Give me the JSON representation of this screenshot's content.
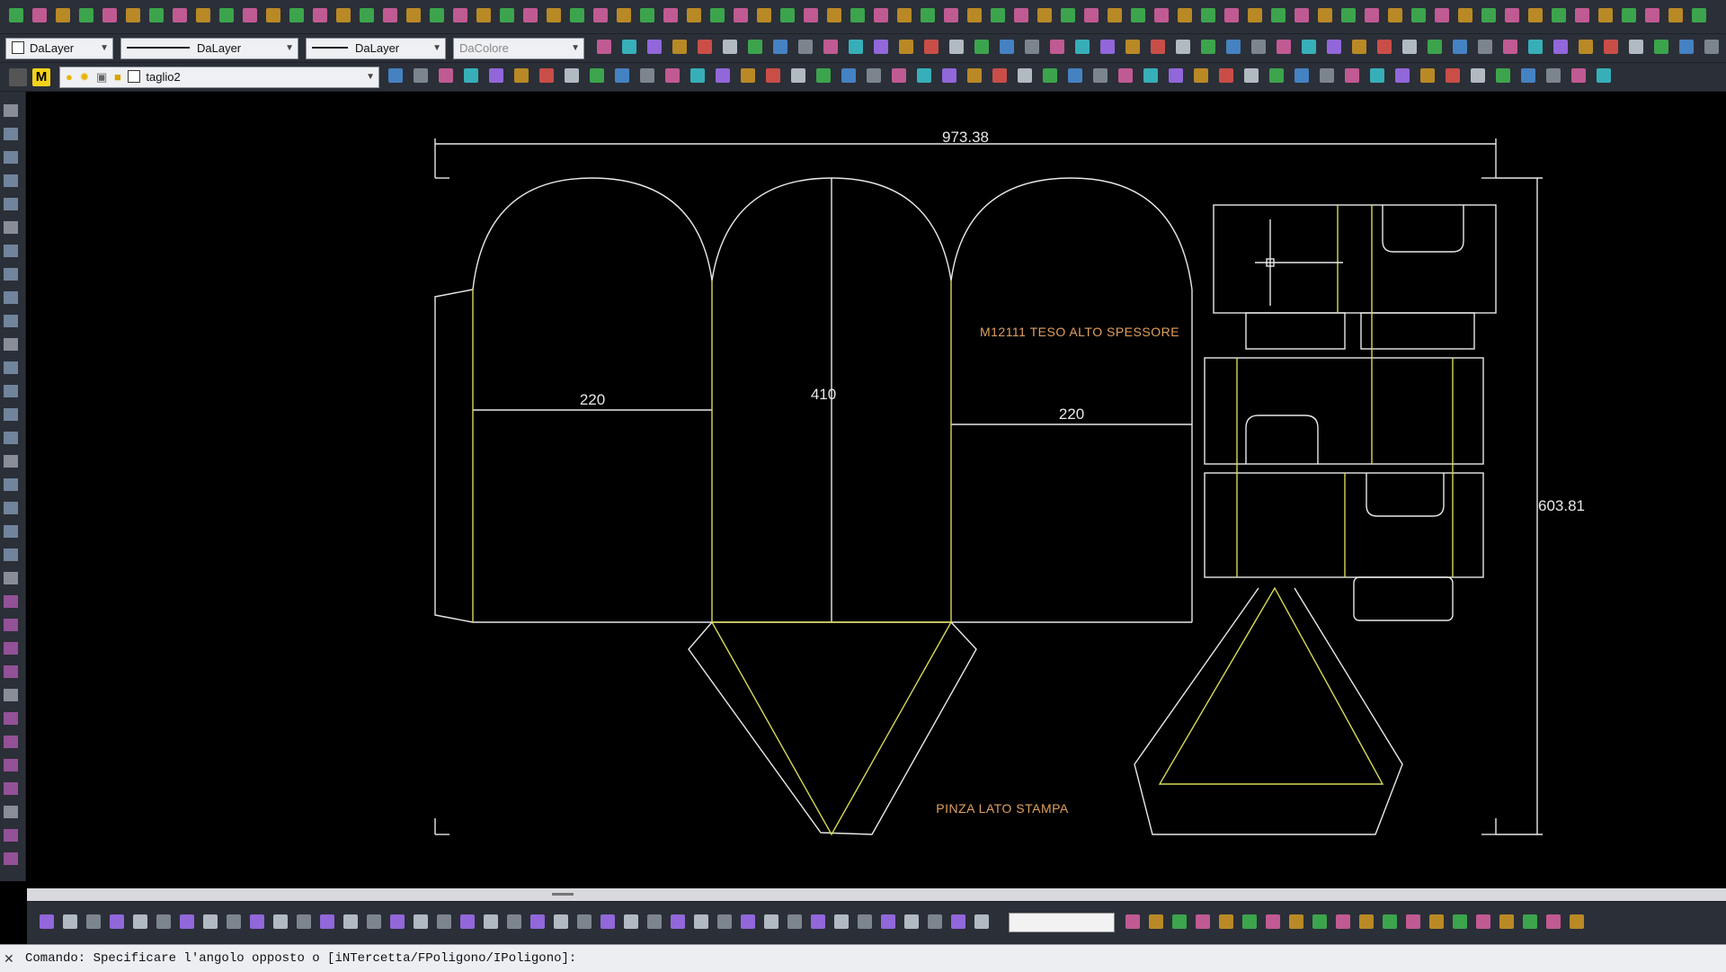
{
  "toolbar": {
    "layer_combo": "DaLayer",
    "linetype_combo": "DaLayer",
    "lineweight_combo": "DaLayer",
    "color_combo": "DaColore",
    "current_layer": "taglio2",
    "text_style_icon": "M"
  },
  "drawing": {
    "dim_total_width": "973.38",
    "dim_total_height": "603.81",
    "dim_left_panel": "220",
    "dim_center_panel": "410",
    "dim_right_panel": "220",
    "annotation_material": "M12111 TESO ALTO SPESSORE",
    "annotation_grip": "PINZA LATO STAMPA",
    "colors": {
      "cut": "#e8e8e8",
      "crease": "#d8d85a",
      "dimension": "#e8e8e8",
      "text_orange": "#e0a060"
    }
  },
  "command": {
    "prompt": "Comando: Specificare l'angolo opposto o [iNTercetta/FPoligono/IPoligono]:"
  }
}
